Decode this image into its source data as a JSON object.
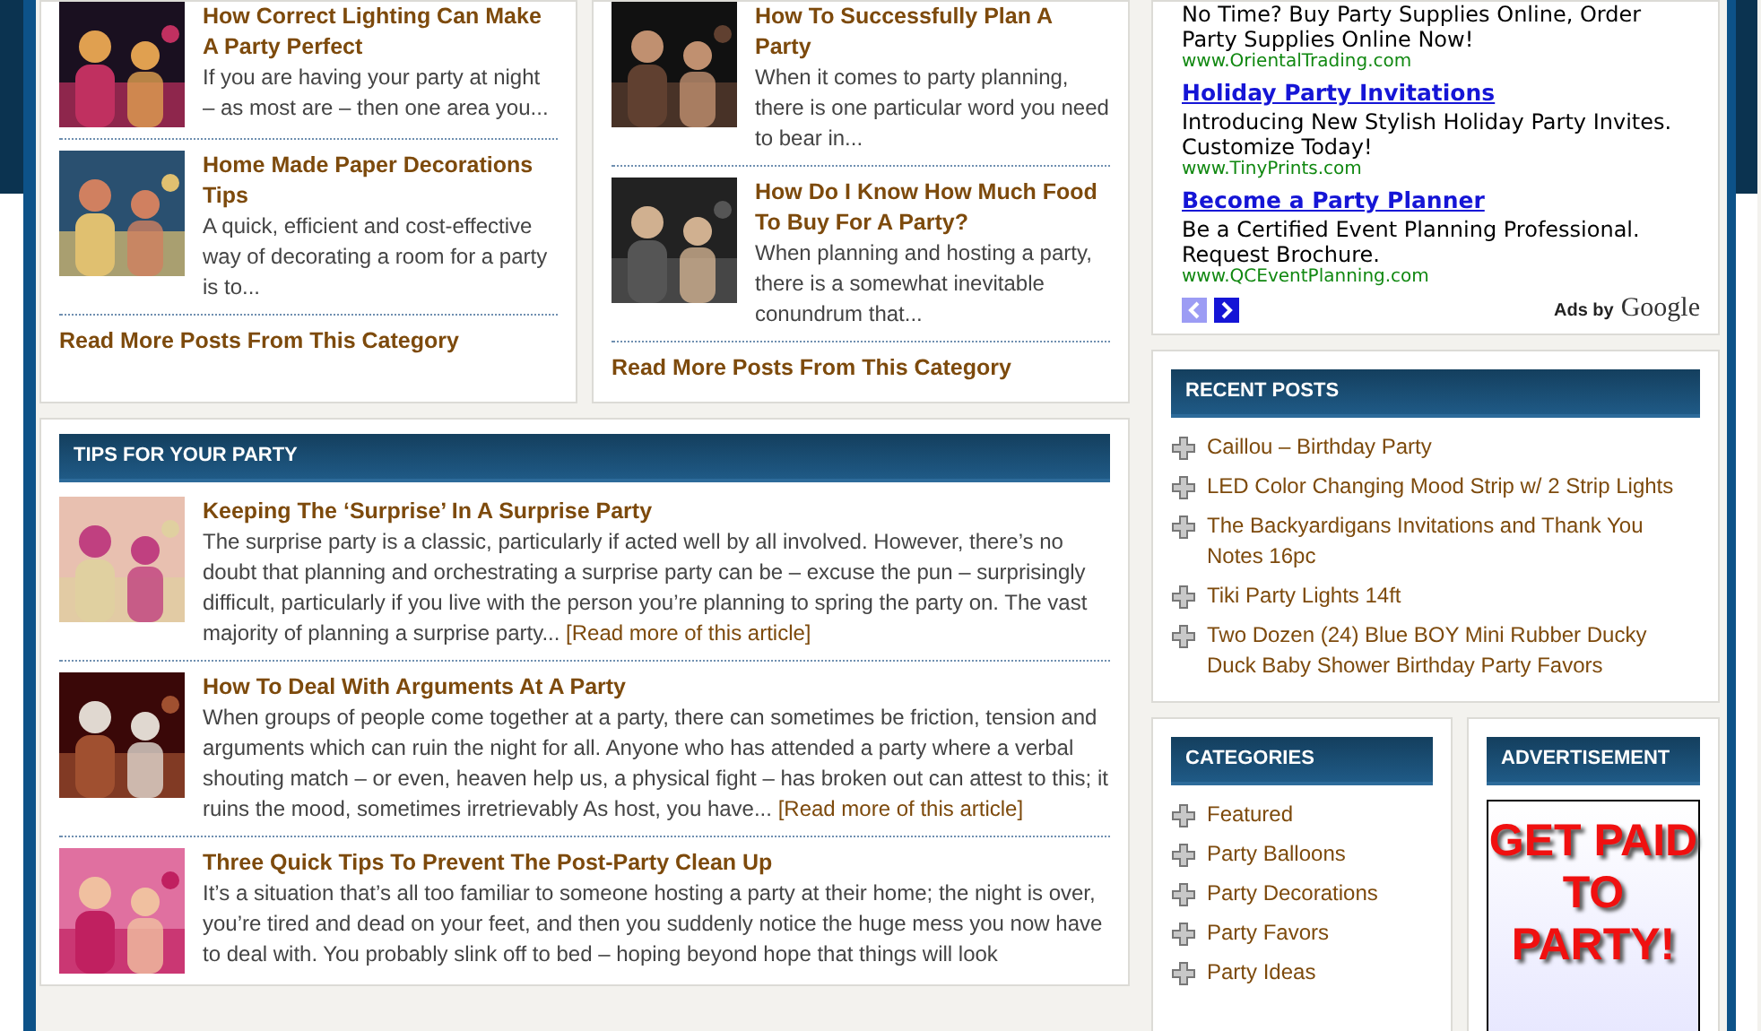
{
  "category_boxes": [
    {
      "posts": [
        {
          "title": "How Correct Lighting Can Make A Party Perfect",
          "excerpt": "If you are having your party at night – as most are – then one area you..."
        },
        {
          "title": "Home Made Paper Decorations Tips",
          "excerpt": "A quick, efficient and cost-effective way of decorating a room for a party is to..."
        }
      ],
      "more_link": "Read More Posts From This Category"
    },
    {
      "posts": [
        {
          "title": "How To Successfully Plan A Party",
          "excerpt": "When it comes to party planning, there is one particular word you need to bear in..."
        },
        {
          "title": "How Do I Know How Much Food To Buy For A Party?",
          "excerpt": "When planning and hosting a party, there is a somewhat inevitable conundrum that..."
        }
      ],
      "more_link": "Read More Posts From This Category"
    }
  ],
  "tips": {
    "heading": "TIPS FOR YOUR PARTY",
    "articles": [
      {
        "title": "Keeping The ‘Surprise’ In A Surprise Party",
        "excerpt": "The surprise party is a classic, particularly if acted well by all involved. However, there’s no doubt that planning and orchestrating a surprise party can be – excuse the pun – surprisingly difficult, particularly if you live with the person you’re planning to spring the party on. The vast majority of planning a surprise party...",
        "read_more": "[Read more of this article]"
      },
      {
        "title": "How To Deal With Arguments At A Party",
        "excerpt": "When groups of people come together at a party, there can sometimes be friction, tension and arguments which can ruin the night for all. Anyone who has attended a party where a verbal shouting match – or even, heaven help us, a physical fight – has broken out can attest to this; it ruins the mood, sometimes irretrievably As host, you have...",
        "read_more": "[Read more of this article]"
      },
      {
        "title": "Three Quick Tips To Prevent The Post-Party Clean Up",
        "excerpt": "It’s a situation that’s all too familiar to someone hosting a party at their home; the night is over, you’re tired and dead on your feet, and then you suddenly notice the huge mess you now have to deal with. You probably slink off to bed – hoping beyond hope that things will look"
      }
    ]
  },
  "ad_unit": {
    "ads": [
      {
        "text": "No Time? Buy Party Supplies Online, Order Party Supplies Online Now!",
        "url": "www.OrientalTrading.com"
      },
      {
        "title": "Holiday Party Invitations",
        "text": "Introducing New Stylish Holiday Party Invites. Customize Today!",
        "url": "www.TinyPrints.com"
      },
      {
        "title": "Become a Party Planner",
        "text": "Be a Certified Event Planning Professional. Request Brochure.",
        "url": "www.QCEventPlanning.com"
      }
    ],
    "nav": [
      {
        "kind": "prev",
        "disabled": true
      },
      {
        "kind": "next",
        "disabled": false
      }
    ],
    "ads_by": "Ads by",
    "brand": "Google"
  },
  "recent_posts": {
    "heading": "RECENT POSTS",
    "items": [
      "Caillou – Birthday Party",
      "LED Color Changing Mood Strip w/ 2 Strip Lights",
      "The Backyardigans Invitations and Thank You Notes 16pc",
      "Tiki Party Lights 14ft",
      "Two Dozen (24) Blue BOY Mini Rubber Ducky Duck Baby Shower Birthday Party Favors"
    ]
  },
  "categories": {
    "heading": "CATEGORIES",
    "items": [
      "Featured",
      "Party Balloons",
      "Party Decorations",
      "Party Favors",
      "Party Ideas"
    ]
  },
  "advertisement": {
    "heading": "ADVERTISEMENT",
    "banner": [
      "GET PAID",
      "TO",
      "PARTY!"
    ]
  }
}
